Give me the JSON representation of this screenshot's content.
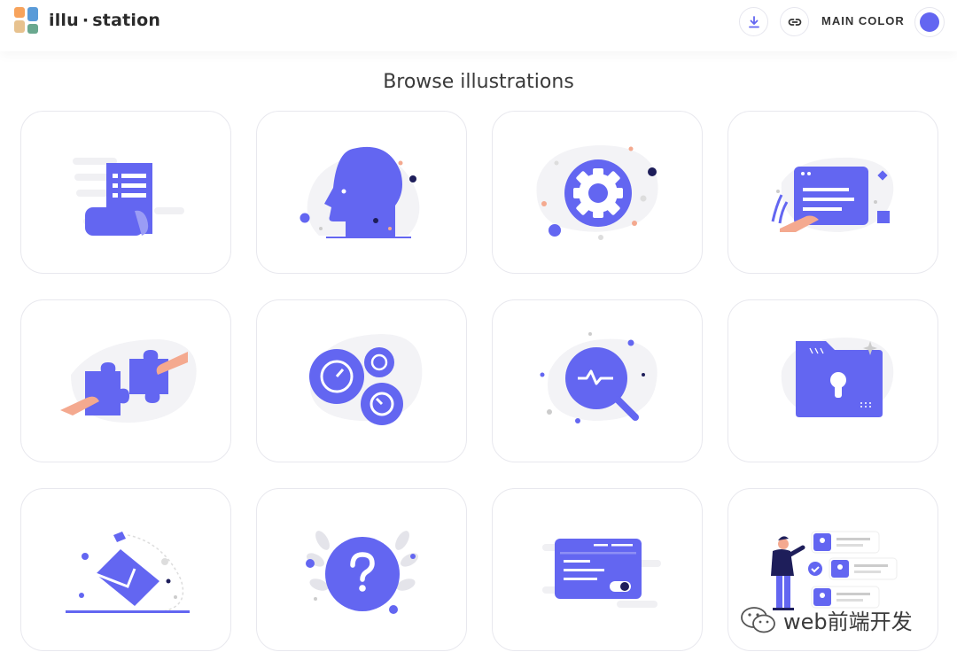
{
  "app": {
    "logo_text_left": "illu",
    "logo_separator": "·",
    "logo_text_right": "station"
  },
  "header": {
    "download_icon": "download-icon",
    "link_icon": "link-icon",
    "main_color_label": "MAIN COLOR",
    "main_color": "#6366f1"
  },
  "page": {
    "title": "Browse illustrations"
  },
  "illustrations": [
    {
      "icon": "document-scroll-illustration"
    },
    {
      "icon": "head-profile-illustration"
    },
    {
      "icon": "settings-gear-illustration"
    },
    {
      "icon": "browser-window-illustration"
    },
    {
      "icon": "puzzle-pieces-illustration"
    },
    {
      "icon": "analytics-gauges-illustration"
    },
    {
      "icon": "search-pulse-illustration"
    },
    {
      "icon": "locked-folder-illustration"
    },
    {
      "icon": "envelope-mail-illustration"
    },
    {
      "icon": "question-mark-illustration"
    },
    {
      "icon": "credit-card-illustration"
    },
    {
      "icon": "person-profiles-illustration"
    }
  ],
  "watermark": {
    "text": "web前端开发"
  }
}
